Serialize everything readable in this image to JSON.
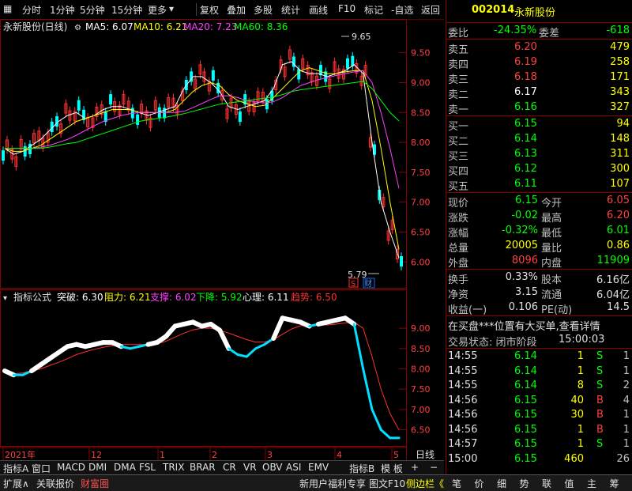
{
  "toolbar": {
    "items": [
      "分时",
      "1分钟",
      "5分钟",
      "15分钟",
      "更多",
      "复权",
      "叠加",
      "多股",
      "统计",
      "画线",
      "F10",
      "标记",
      "-自选",
      "返回"
    ]
  },
  "main_chart": {
    "stock_title": "永新股份(日线)",
    "ma": [
      {
        "label": "MA5: 6.07",
        "color": "#ffffff"
      },
      {
        "label": "MA10: 6.21",
        "color": "#ffff00"
      },
      {
        "label": "MA20: 7.23",
        "color": "#ff40ff"
      },
      {
        "label": "MA60: 8.36",
        "color": "#00ff00"
      }
    ],
    "high_label": "9.65",
    "low_label": "5.79",
    "marker_s": "S",
    "marker_cai": "财"
  },
  "indicator": {
    "title": "指标公式",
    "items": [
      {
        "label": "突破: 6.30",
        "color": "#ffffff"
      },
      {
        "label": "阻力: 6.21",
        "color": "#ffff00"
      },
      {
        "label": "支撑: 6.02",
        "color": "#ff40ff"
      },
      {
        "label": "下降: 5.92",
        "color": "#00ff00"
      },
      {
        "label": "心理: 6.11",
        "color": "#ffffff"
      },
      {
        "label": "趋势: 6.50",
        "color": "#ff3030"
      }
    ]
  },
  "time_axis": {
    "labels": [
      {
        "t": "2021年",
        "x": 4
      },
      {
        "t": "12",
        "x": 113
      },
      {
        "t": "1",
        "x": 200
      },
      {
        "t": "2",
        "x": 266
      },
      {
        "t": "3",
        "x": 336
      },
      {
        "t": "4",
        "x": 424
      },
      {
        "t": "5",
        "x": 496
      }
    ],
    "period": "日线"
  },
  "chart_data": [
    {
      "type": "candlestick",
      "title": "永新股份(日线)",
      "y_ticks": [
        "9.50",
        "9.00",
        "8.50",
        "8.00",
        "7.50",
        "7.00",
        "6.50",
        "6.00"
      ],
      "ylim": [
        5.7,
        9.8
      ],
      "series": [
        {
          "name": "MA5",
          "values": [
            7.9,
            7.8,
            7.85,
            7.95,
            8.05,
            8.2,
            8.35,
            8.45,
            8.5,
            8.4,
            8.45,
            8.55,
            8.6,
            8.6,
            8.55,
            8.5,
            8.45,
            8.5,
            8.55,
            8.6,
            8.9,
            9.1,
            9.1,
            9.0,
            8.85,
            8.6,
            8.55,
            8.6,
            8.65,
            8.7,
            8.9,
            9.3,
            9.35,
            9.2,
            9.15,
            9.15,
            9.1,
            9.15,
            9.2,
            9.3,
            9.15,
            8.0,
            7.0,
            6.5,
            6.07
          ]
        },
        {
          "name": "MA10",
          "values": [
            7.9,
            7.85,
            7.85,
            7.9,
            7.95,
            8.05,
            8.15,
            8.25,
            8.35,
            8.4,
            8.45,
            8.5,
            8.55,
            8.55,
            8.55,
            8.5,
            8.5,
            8.5,
            8.5,
            8.55,
            8.7,
            8.85,
            8.95,
            9.0,
            8.95,
            8.8,
            8.7,
            8.65,
            8.6,
            8.62,
            8.75,
            8.9,
            9.05,
            9.2,
            9.25,
            9.2,
            9.15,
            9.15,
            9.18,
            9.2,
            9.2,
            8.7,
            7.9,
            7.0,
            6.21
          ]
        },
        {
          "name": "MA20",
          "values": [
            7.9,
            7.9,
            7.9,
            7.9,
            7.92,
            7.95,
            8.0,
            8.05,
            8.12,
            8.2,
            8.28,
            8.35,
            8.4,
            8.45,
            8.48,
            8.5,
            8.5,
            8.5,
            8.5,
            8.5,
            8.52,
            8.58,
            8.65,
            8.72,
            8.78,
            8.78,
            8.75,
            8.7,
            8.68,
            8.66,
            8.68,
            8.75,
            8.85,
            8.95,
            9.0,
            9.05,
            9.08,
            9.12,
            9.15,
            9.18,
            9.2,
            9.0,
            8.5,
            7.9,
            7.23
          ]
        },
        {
          "name": "MA60",
          "values": [
            7.9,
            7.9,
            7.9,
            7.9,
            7.9,
            7.92,
            7.95,
            7.98,
            8.0,
            8.05,
            8.1,
            8.15,
            8.2,
            8.25,
            8.3,
            8.35,
            8.38,
            8.4,
            8.42,
            8.45,
            8.48,
            8.52,
            8.56,
            8.6,
            8.64,
            8.66,
            8.68,
            8.7,
            8.72,
            8.74,
            8.76,
            8.8,
            8.85,
            8.88,
            8.9,
            8.92,
            8.94,
            8.96,
            8.98,
            9.0,
            9.02,
            8.9,
            8.7,
            8.5,
            8.36
          ]
        }
      ]
    },
    {
      "type": "line",
      "title": "指标公式",
      "y_ticks": [
        "9.00",
        "8.50",
        "8.00",
        "7.50",
        "7.00",
        "6.50"
      ],
      "ylim": [
        6.2,
        9.45
      ],
      "series": [
        {
          "name": "突破",
          "values": [
            7.95,
            7.85,
            7.85,
            7.95,
            8.1,
            8.25,
            8.4,
            8.55,
            8.6,
            8.55,
            8.6,
            8.65,
            8.65,
            8.55,
            8.5,
            8.55,
            8.6,
            8.65,
            8.8,
            9.05,
            9.1,
            9.15,
            9.05,
            9.1,
            8.95,
            8.5,
            8.35,
            8.3,
            8.5,
            8.6,
            8.75,
            9.25,
            9.2,
            9.15,
            9.05,
            9.1,
            9.15,
            9.2,
            9.25,
            9.1,
            8.0,
            7.0,
            6.5,
            6.3,
            6.3
          ]
        },
        {
          "name": "趋势",
          "values": [
            7.9,
            7.88,
            7.9,
            7.95,
            8.0,
            8.08,
            8.16,
            8.25,
            8.35,
            8.42,
            8.48,
            8.53,
            8.57,
            8.6,
            8.6,
            8.6,
            8.6,
            8.62,
            8.68,
            8.78,
            8.88,
            8.96,
            9.0,
            9.0,
            8.95,
            8.88,
            8.8,
            8.72,
            8.66,
            8.66,
            8.72,
            8.85,
            8.98,
            9.06,
            9.08,
            9.08,
            9.08,
            9.1,
            9.13,
            9.15,
            9.0,
            8.3,
            7.5,
            6.9,
            6.5
          ]
        }
      ]
    }
  ],
  "quote": {
    "code": "002014",
    "name": "永新股份",
    "weibi_label": "委比",
    "weibi": "-24.35%",
    "weicha_label": "委差",
    "weicha": "-618",
    "sells": [
      {
        "label": "卖五",
        "price": "6.20",
        "vol": "479"
      },
      {
        "label": "卖四",
        "price": "6.19",
        "vol": "258"
      },
      {
        "label": "卖三",
        "price": "6.18",
        "vol": "171"
      },
      {
        "label": "卖二",
        "price": "6.17",
        "vol": "343"
      },
      {
        "label": "卖一",
        "price": "6.16",
        "vol": "327"
      }
    ],
    "buys": [
      {
        "label": "买一",
        "price": "6.15",
        "vol": "94"
      },
      {
        "label": "买二",
        "price": "6.14",
        "vol": "148"
      },
      {
        "label": "买三",
        "price": "6.13",
        "vol": "311"
      },
      {
        "label": "买四",
        "price": "6.12",
        "vol": "300"
      },
      {
        "label": "买五",
        "price": "6.11",
        "vol": "107"
      }
    ],
    "stats": [
      {
        "l1": "现价",
        "v1": "6.15",
        "l2": "今开",
        "v2": "6.05"
      },
      {
        "l1": "涨跌",
        "v1": "-0.02",
        "l2": "最高",
        "v2": "6.20"
      },
      {
        "l1": "涨幅",
        "v1": "-0.32%",
        "l2": "最低",
        "v2": "6.01"
      },
      {
        "l1": "总量",
        "v1": "20005",
        "l2": "量比",
        "v2": "0.86"
      },
      {
        "l1": "外盘",
        "v1": "8096",
        "l2": "内盘",
        "v2": "11909"
      }
    ],
    "fund": [
      {
        "l1": "换手",
        "v1": "0.33%",
        "l2": "股本",
        "v2": "6.16亿"
      },
      {
        "l1": "净资",
        "v1": "3.15",
        "l2": "流通",
        "v2": "6.04亿"
      },
      {
        "l1": "收益(一)",
        "v1": "0.106",
        "l2": "PE(动)",
        "v2": "14.5"
      }
    ],
    "notice": "在买盘***位置有大买单,查看详情",
    "trade_status_label": "交易状态: 闭市阶段",
    "trade_status_time": "15:00:03",
    "ticks": [
      {
        "time": "14:55",
        "price": "6.14",
        "vol": "1",
        "bs": "S",
        "n": "1"
      },
      {
        "time": "14:55",
        "price": "6.14",
        "vol": "1",
        "bs": "S",
        "n": "1"
      },
      {
        "time": "14:55",
        "price": "6.14",
        "vol": "8",
        "bs": "S",
        "n": "2"
      },
      {
        "time": "14:56",
        "price": "6.15",
        "vol": "40",
        "bs": "B",
        "n": "4"
      },
      {
        "time": "14:56",
        "price": "6.15",
        "vol": "30",
        "bs": "B",
        "n": "1"
      },
      {
        "time": "14:56",
        "price": "6.15",
        "vol": "1",
        "bs": "B",
        "n": "1"
      },
      {
        "time": "14:57",
        "price": "6.15",
        "vol": "1",
        "bs": "S",
        "n": "1"
      },
      {
        "time": "15:00",
        "price": "6.15",
        "vol": "460",
        "bs": "",
        "n": "26"
      }
    ]
  },
  "tabs": [
    "指标A",
    "窗口",
    "MACD",
    "DMI",
    "DMA",
    "FSL",
    "TRIX",
    "BRAR",
    "CR",
    "VR",
    "OBV",
    "ASI",
    "EMV",
    "指标B",
    "模 板",
    "+",
    "−"
  ],
  "status_left": [
    "扩展∧",
    "关联报价",
    "财富圈"
  ],
  "status_mid": [
    "新用户福利专享",
    "图文F10",
    "侧边栏《"
  ],
  "status_right": [
    "笔",
    "价",
    "细",
    "势",
    "联",
    "值",
    "主",
    "筹"
  ]
}
